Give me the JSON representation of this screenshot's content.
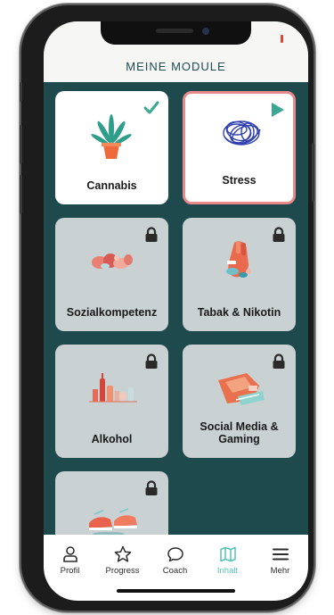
{
  "header": {
    "title": "MEINE MODULE"
  },
  "colors": {
    "background": "#1e4a4e",
    "accent": "#3aa794",
    "active_border": "#e8898b",
    "locked_card": "#c9d1d3",
    "tab_active": "#54c3b5"
  },
  "modules": [
    {
      "label": "Cannabis",
      "status": "completed",
      "icon": "checkmark-icon",
      "illustration": "cannabis-plant"
    },
    {
      "label": "Stress",
      "status": "in-progress",
      "icon": "play-icon",
      "illustration": "scribble-ball"
    },
    {
      "label": "Sozialkompetenz",
      "status": "locked",
      "icon": "lock-icon",
      "illustration": "social-group"
    },
    {
      "label": "Tabak & Nikotin",
      "status": "locked",
      "icon": "lock-icon",
      "illustration": "tobacco-hand"
    },
    {
      "label": "Alkohol",
      "status": "locked",
      "icon": "lock-icon",
      "illustration": "bottles"
    },
    {
      "label": "Social Media & Gaming",
      "label_line1": "Social Media &",
      "label_line2": "Gaming",
      "status": "locked",
      "icon": "lock-icon",
      "illustration": "phone-books"
    },
    {
      "label": "",
      "status": "locked",
      "icon": "lock-icon",
      "illustration": "shoes"
    }
  ],
  "tabbar": {
    "items": [
      {
        "label": "Profil",
        "icon": "user-icon"
      },
      {
        "label": "Progress",
        "icon": "star-icon"
      },
      {
        "label": "Coach",
        "icon": "chat-bubble-icon"
      },
      {
        "label": "Inhalt",
        "icon": "map-icon",
        "active": true
      },
      {
        "label": "Mehr",
        "icon": "menu-icon"
      }
    ]
  }
}
